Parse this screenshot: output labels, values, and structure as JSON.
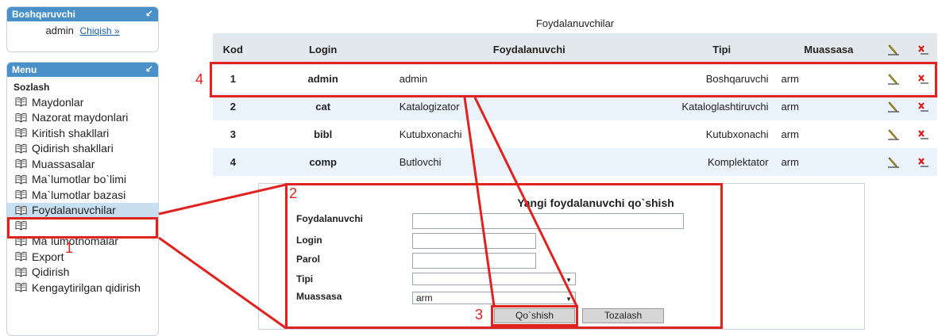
{
  "admin_panel": {
    "title": "Boshqaruvchi",
    "user": "admin",
    "logout": "Chiqish »",
    "collapse_icon": "collapse-arrow-icon"
  },
  "menu": {
    "title": "Menu",
    "section": "Sozlash",
    "items": [
      "Maydonlar",
      "Nazorat maydonlari",
      "Kiritish shakllari",
      "Qidirish shakllari",
      "Muassasalar",
      "Ma`lumotlar bo`limi",
      "Ma`lumotlar bazasi",
      "Foydalanuvchilar",
      "",
      "Ma`lumotnomalar",
      "Export",
      "Qidirish",
      "Kengaytirilgan qidirish"
    ],
    "active_index": 7,
    "item_icon": "book-icon"
  },
  "users_table": {
    "title": "Foydalanuvchilar",
    "columns": {
      "kod": "Kod",
      "login": "Login",
      "fullname": "Foydalanuvchi",
      "tipi": "Tipi",
      "muassasa": "Muassasa"
    },
    "rows": [
      {
        "kod": "1",
        "login": "admin",
        "fullname": "admin",
        "tipi": "Boshqaruvchi",
        "muassasa": "arm"
      },
      {
        "kod": "2",
        "login": "cat",
        "fullname": "Katalogizator",
        "tipi": "Kataloglashtiruvchi",
        "muassasa": "arm"
      },
      {
        "kod": "3",
        "login": "bibl",
        "fullname": "Kutubxonachi",
        "tipi": "Kutubxonachi",
        "muassasa": "arm"
      },
      {
        "kod": "4",
        "login": "comp",
        "fullname": "Butlovchi",
        "tipi": "Komplektator",
        "muassasa": "arm"
      }
    ],
    "edit_icon": "pencil-edit-icon",
    "delete_icon": "delete-x-icon"
  },
  "new_user_form": {
    "title": "Yangi foydalanuvchi qo`shish",
    "labels": {
      "fullname": "Foydalanuvchi",
      "login": "Login",
      "password": "Parol",
      "type": "Tipi",
      "institution": "Muassasa"
    },
    "values": {
      "fullname": "",
      "login": "",
      "password": "",
      "type": "",
      "institution": "arm"
    },
    "add_button": "Qo`shish",
    "clear_button": "Tozalash"
  },
  "annotations": {
    "n1": "1",
    "n2": "2",
    "n3": "3",
    "n4": "4",
    "color": "#e0231f"
  }
}
